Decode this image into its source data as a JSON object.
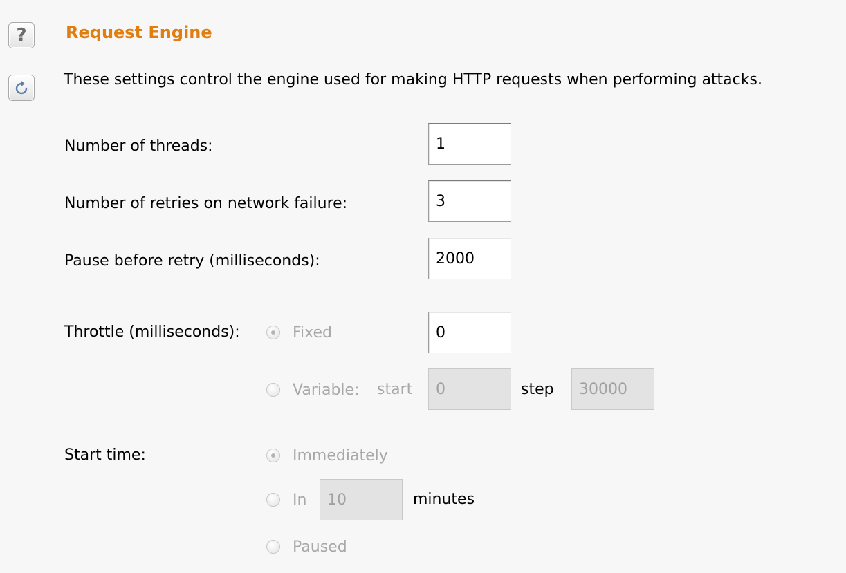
{
  "section": {
    "title": "Request Engine",
    "description": "These settings control the engine used for making HTTP requests when performing attacks."
  },
  "icons": {
    "help": "help-question-icon",
    "reset": "restore-defaults-icon"
  },
  "fields": {
    "threads": {
      "label": "Number of threads:",
      "value": "1"
    },
    "retries": {
      "label": "Number of retries on network failure:",
      "value": "3"
    },
    "pause": {
      "label": "Pause before retry (milliseconds):",
      "value": "2000"
    }
  },
  "throttle": {
    "label": "Throttle (milliseconds):",
    "fixed_label": "Fixed",
    "fixed_value": "0",
    "variable_label": "Variable:",
    "start_label": "start",
    "start_value": "0",
    "step_label": "step",
    "step_value": "30000",
    "selected": "fixed"
  },
  "start_time": {
    "label": "Start time:",
    "immediately_label": "Immediately",
    "in_label": "In",
    "in_value": "10",
    "minutes_label": "minutes",
    "paused_label": "Paused",
    "selected": "immediately"
  },
  "colors": {
    "accent_title": "#e07e10",
    "background": "#f7f7f7",
    "disabled_text": "#a8a8a8",
    "disabled_field": "#e3e3e3"
  }
}
